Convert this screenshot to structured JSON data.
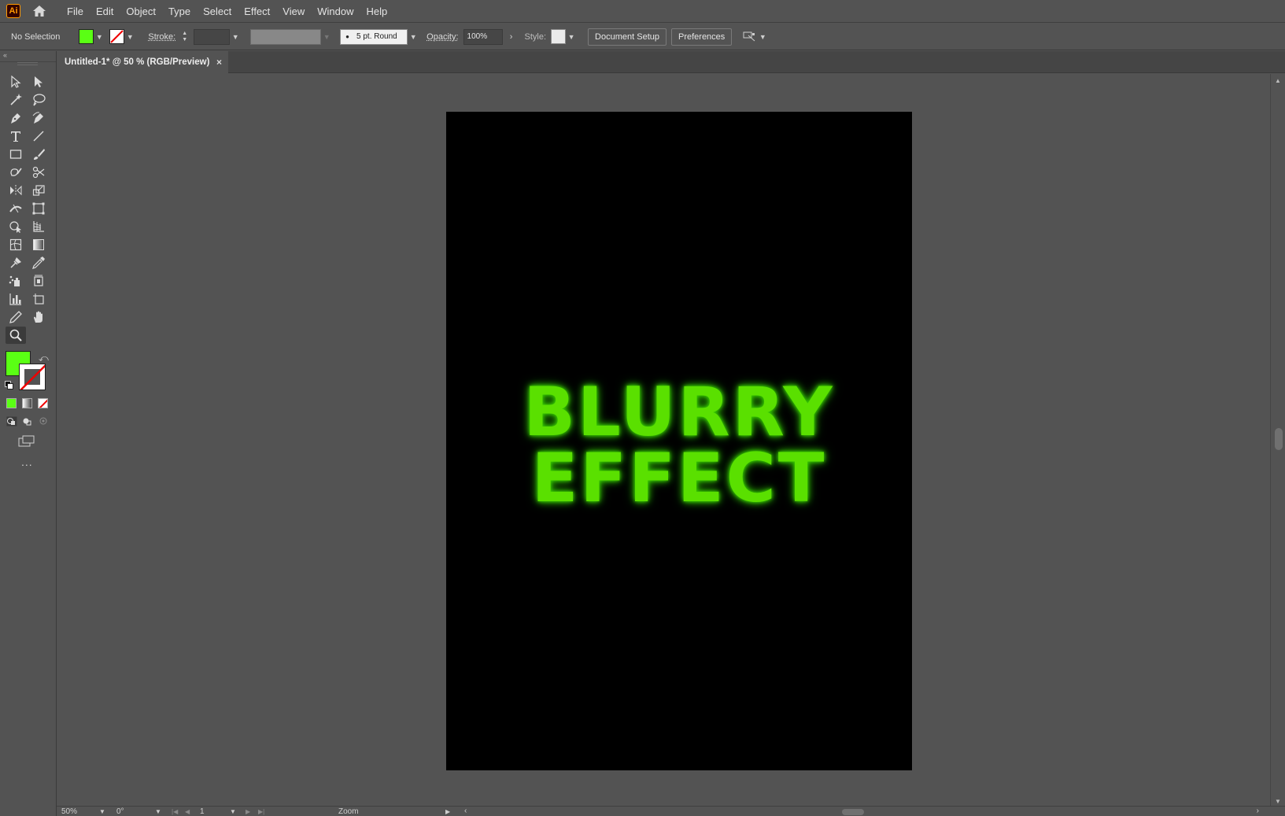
{
  "app": {
    "logo_text": "Ai",
    "menu": [
      "File",
      "Edit",
      "Object",
      "Type",
      "Select",
      "Effect",
      "View",
      "Window",
      "Help"
    ]
  },
  "control_bar": {
    "selection_status": "No Selection",
    "fill_color": "#5aff14",
    "stroke_label": "Stroke:",
    "brush_label": "5 pt. Round",
    "opacity_label": "Opacity:",
    "opacity_value": "100%",
    "style_label": "Style:",
    "document_setup": "Document Setup",
    "preferences": "Preferences"
  },
  "document": {
    "tab_title": "Untitled-1* @ 50 % (RGB/Preview)",
    "close_glyph": "×"
  },
  "artboard": {
    "background": "#000000",
    "text_line1": "BLURRY",
    "text_line2": "EFFECT",
    "text_color": "#5ae000"
  },
  "toolbar": {
    "fill_color": "#5aff14",
    "more_tools": "..."
  },
  "status_bar": {
    "zoom": "50%",
    "rotation": "0°",
    "artboard_number": "1",
    "tool_name": "Zoom"
  }
}
